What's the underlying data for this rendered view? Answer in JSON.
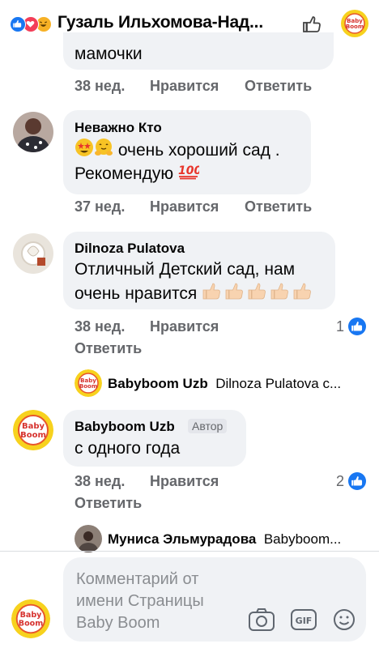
{
  "header": {
    "title": "Гузаль Ильхомова-Над..."
  },
  "thread": [
    {
      "id": "c0",
      "text_tail": "мамочки",
      "time": "38 нед.",
      "like_label": "Нравится",
      "reply_label": "Ответить"
    },
    {
      "id": "c1",
      "author": "Неважно Кто",
      "text_line1": "очень хороший сад .",
      "text_line2": "Рекомендую",
      "time": "37 нед.",
      "like_label": "Нравится",
      "reply_label": "Ответить"
    },
    {
      "id": "c2",
      "author": "Dilnoza Pulatova",
      "text_line1": "Отличный Детский сад, нам",
      "text_line2": "очень нравится",
      "time": "38 нед.",
      "like_label": "Нравится",
      "reply_label": "Ответить",
      "reaction_count": "1",
      "reply_preview": {
        "author": "Babyboom Uzb",
        "snippet": "Dilnoza Pulatova c..."
      }
    },
    {
      "id": "c3",
      "author": "Babyboom Uzb",
      "author_badge": "Автор",
      "text_line1": "с одного года",
      "time": "38 нед.",
      "like_label": "Нравится",
      "reply_label": "Ответить",
      "reaction_count": "2",
      "reply_preview": {
        "author": "Муниса Эльмурадова",
        "snippet": "Babyboom..."
      }
    }
  ],
  "composer": {
    "placeholder": "Комментарий от имени Страницы Baby Boom"
  },
  "colors": {
    "accent": "#1877f2",
    "bubble": "#f0f2f5",
    "meta": "#65676b",
    "brand_yellow": "#f7d21e"
  }
}
